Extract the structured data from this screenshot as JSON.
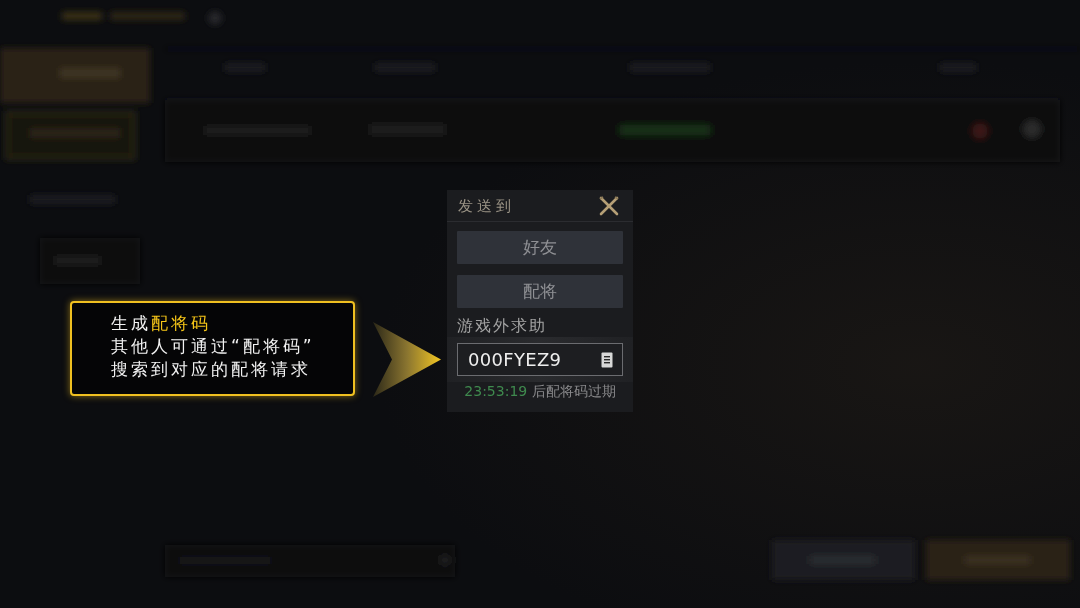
{
  "callout": {
    "lines": [
      "生成**配将码**",
      "其他人可通过“配将码”",
      "搜索到对应的配将请求"
    ]
  },
  "dialog": {
    "title": "发送到",
    "buttons": [
      "好友",
      "配将"
    ],
    "section_label": "游戏外求助",
    "code_field": {
      "value": "000FYEZ9"
    },
    "expiry": {
      "countdown": "23:53:19",
      "message": "后配将码过期"
    }
  }
}
